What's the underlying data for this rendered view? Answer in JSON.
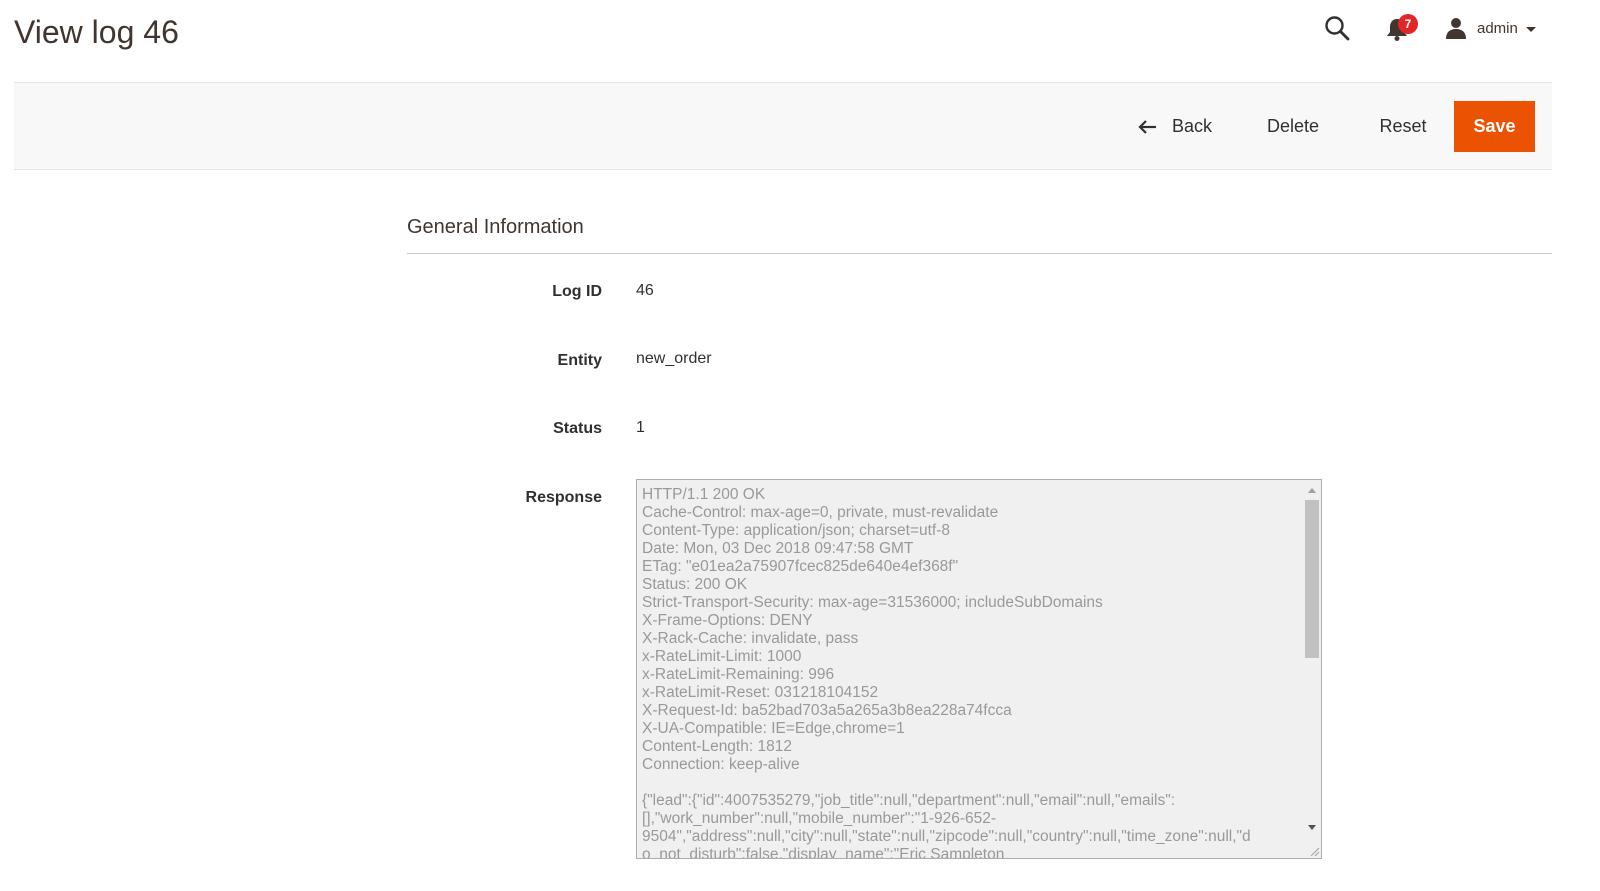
{
  "header": {
    "title": "View log 46",
    "notifications_count": "7",
    "user_name": "admin",
    "icons": {
      "search": "search-icon",
      "notifications": "bell-icon",
      "user": "user-icon",
      "dropdown": "caret-down-icon"
    }
  },
  "actions": {
    "back_label": "Back",
    "delete_label": "Delete",
    "reset_label": "Reset",
    "save_label": "Save",
    "accent_color": "#eb5202"
  },
  "section": {
    "title": "General Information"
  },
  "fields": {
    "log_id": {
      "label": "Log ID",
      "value": "46"
    },
    "entity": {
      "label": "Entity",
      "value": "new_order"
    },
    "status": {
      "label": "Status",
      "value": "1"
    },
    "response": {
      "label": "Response",
      "value": "HTTP/1.1 200 OK\nCache-Control: max-age=0, private, must-revalidate\nContent-Type: application/json; charset=utf-8\nDate: Mon, 03 Dec 2018 09:47:58 GMT\nETag: \"e01ea2a75907fcec825de640e4ef368f\"\nStatus: 200 OK\nStrict-Transport-Security: max-age=31536000; includeSubDomains\nX-Frame-Options: DENY\nX-Rack-Cache: invalidate, pass\nx-RateLimit-Limit: 1000\nx-RateLimit-Remaining: 996\nx-RateLimit-Reset: 031218104152\nX-Request-Id: ba52bad703a5a265a3b8ea228a74fcca\nX-UA-Compatible: IE=Edge,chrome=1\nContent-Length: 1812\nConnection: keep-alive\n\n{\"lead\":{\"id\":4007535279,\"job_title\":null,\"department\":null,\"email\":null,\"emails\":\n[],\"work_number\":null,\"mobile_number\":\"1-926-652-\n9504\",\"address\":null,\"city\":null,\"state\":null,\"zipcode\":null,\"country\":null,\"time_zone\":null,\"d\no_not_disturb\":false,\"display_name\":\"Eric Sampleton"
    }
  }
}
